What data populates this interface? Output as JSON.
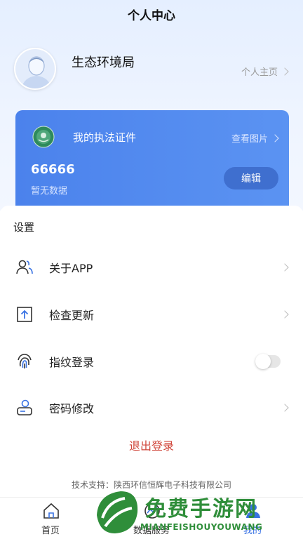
{
  "header": {
    "title": "个人中心"
  },
  "profile": {
    "name": "生态环境局",
    "homepage_label": "个人主页"
  },
  "certificate": {
    "title": "我的执法证件",
    "view_label": "查看图片",
    "number": "66666",
    "status": "暂无数据",
    "edit_label": "编辑"
  },
  "settings": {
    "title": "设置",
    "items": [
      {
        "label": "关于APP",
        "icon": "users-icon"
      },
      {
        "label": "检查更新",
        "icon": "upload-box-icon"
      },
      {
        "label": "指纹登录",
        "icon": "fingerprint-icon",
        "toggle": false
      },
      {
        "label": "密码修改",
        "icon": "password-icon"
      }
    ]
  },
  "logout_label": "退出登录",
  "support": "技术支持：陕西环信恒辉电子科技有限公司",
  "tabs": [
    {
      "label": "首页",
      "icon": "home-icon"
    },
    {
      "label": "数据服务",
      "icon": "data-icon"
    },
    {
      "label": "",
      "icon": ""
    },
    {
      "label": "我的",
      "icon": "user-icon",
      "active": true
    }
  ],
  "watermark": {
    "text": "免费手游网",
    "sub": "MIANFEISHOUYOUWANG"
  },
  "colors": {
    "accent": "#3a73e3",
    "card": "#5089ee",
    "logout": "#d0453a"
  }
}
